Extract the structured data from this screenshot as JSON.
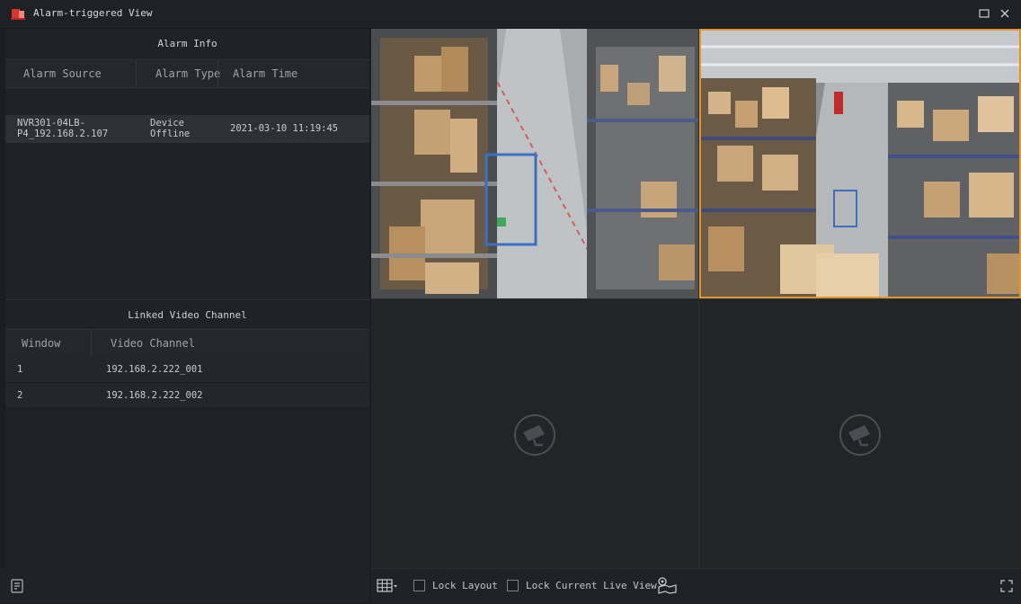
{
  "window": {
    "title": "Alarm-triggered View",
    "icons": {
      "app": "alarm-siren-icon",
      "maximize": "maximize-icon",
      "close": "close-icon"
    }
  },
  "alarm_info": {
    "header": "Alarm Info",
    "columns": [
      "Alarm Source",
      "Alarm Type",
      "Alarm Time"
    ],
    "rows": [
      {
        "source_line1": "NVR301-04LB-",
        "source_line2": "P4_192.168.2.107",
        "type_line1": "Device",
        "type_line2": "Offline",
        "time": "2021-03-10 11:19:45"
      }
    ]
  },
  "linked_channels": {
    "header": "Linked Video Channel",
    "columns": [
      "Window",
      "Video Channel"
    ],
    "rows": [
      {
        "window": "1",
        "channel": "192.168.2.222_001"
      },
      {
        "window": "2",
        "channel": "192.168.2.222_002"
      }
    ]
  },
  "video_tiles": [
    {
      "state": "live",
      "icon": "warehouse-video-feed"
    },
    {
      "state": "live",
      "icon": "warehouse-video-feed",
      "selected": true
    },
    {
      "state": "empty",
      "icon": "camera-placeholder-icon"
    },
    {
      "state": "empty",
      "icon": "camera-placeholder-icon"
    }
  ],
  "toolbar": {
    "lock_layout": "Lock Layout",
    "lock_current_live_view": "Lock Current Live View",
    "icons": [
      "layout-grid-icon",
      "location-map-icon",
      "fullscreen-icon",
      "report-icon"
    ]
  },
  "colors": {
    "accent": "#e0962b",
    "alarm_red": "#d9362b"
  }
}
